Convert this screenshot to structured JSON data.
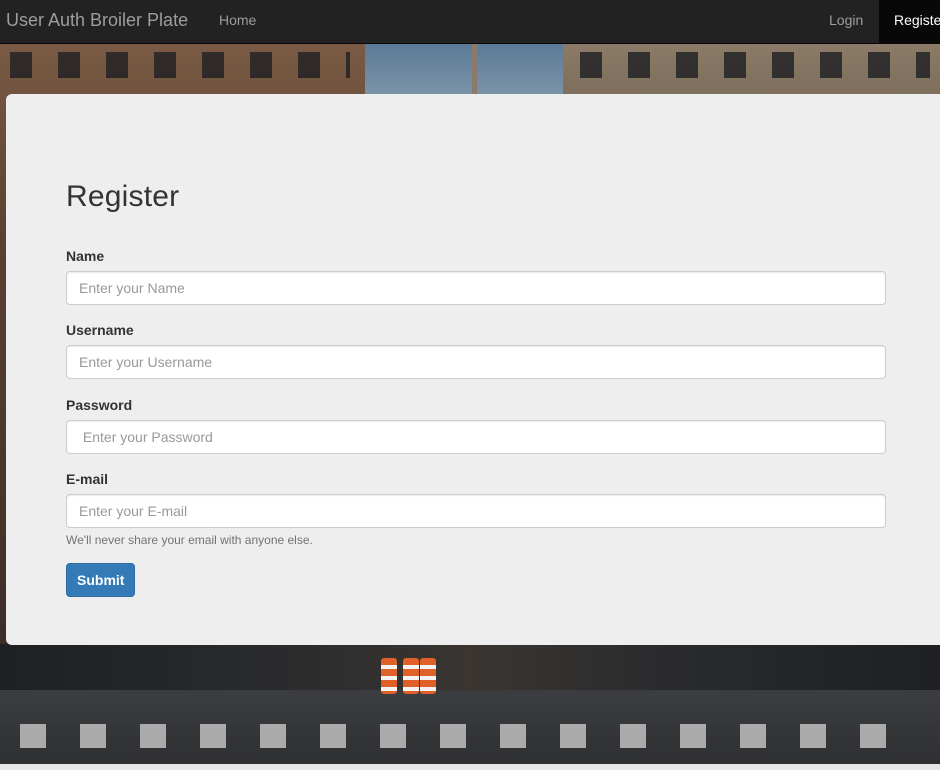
{
  "navbar": {
    "brand": "User Auth Broiler Plate",
    "home_label": "Home",
    "login_label": "Login",
    "register_label": "Register"
  },
  "form": {
    "title": "Register",
    "fields": [
      {
        "label": "Name",
        "placeholder": "Enter your Name"
      },
      {
        "label": "Username",
        "placeholder": "Enter your Username"
      },
      {
        "label": "Password",
        "placeholder": " Enter your Password"
      },
      {
        "label": "E-mail",
        "placeholder": "Enter your E-mail"
      }
    ],
    "email_help": "We'll never share your email with anyone else.",
    "submit_label": "Submit"
  },
  "colors": {
    "navbar_bg": "#222222",
    "navbar_active_bg": "#080808",
    "panel_bg": "#eeeeee",
    "primary_button": "#337ab7"
  }
}
